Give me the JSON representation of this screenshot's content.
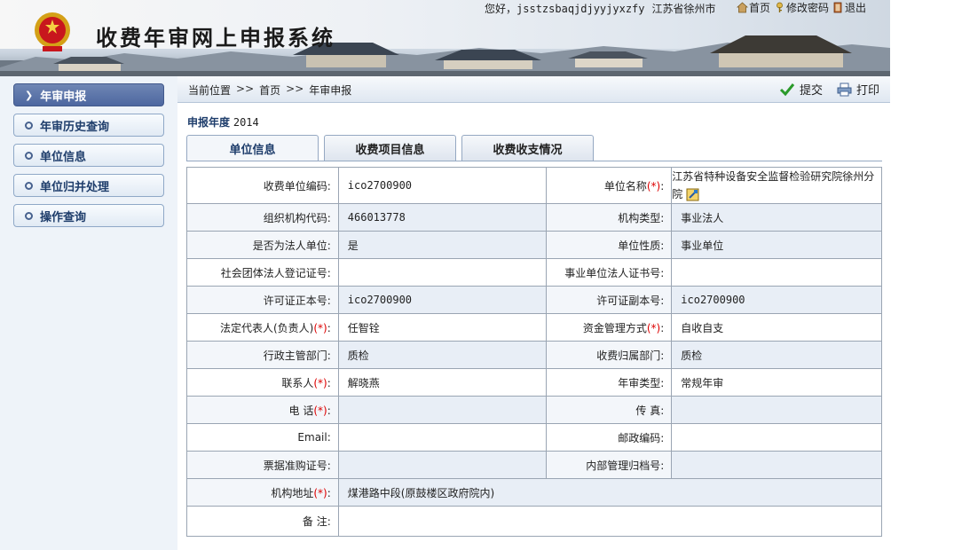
{
  "header": {
    "system_title": "收费年审网上申报系统",
    "greeting": "您好，",
    "username": "jsstzsbaqjdjyyjyxzfy",
    "city": "江苏省徐州市",
    "links": [
      {
        "label": "首页",
        "icon": "home-icon"
      },
      {
        "label": "修改密码",
        "icon": "key-icon"
      },
      {
        "label": "退出",
        "icon": "exit-icon"
      }
    ]
  },
  "sidebar": {
    "items": [
      {
        "label": "年审申报",
        "active": true
      },
      {
        "label": "年审历史查询",
        "active": false
      },
      {
        "label": "单位信息",
        "active": false
      },
      {
        "label": "单位归并处理",
        "active": false
      },
      {
        "label": "操作查询",
        "active": false
      }
    ]
  },
  "breadcrumb": {
    "prefix": "当前位置",
    "sep": ">>",
    "home": "首页",
    "current": "年审申报"
  },
  "actions": {
    "submit": "提交",
    "print": "打印"
  },
  "report_year": {
    "label": "申报年度",
    "value": "2014"
  },
  "tabs": [
    "单位信息",
    "收费项目信息",
    "收费收支情况"
  ],
  "form": {
    "unit_code": {
      "label": "收费单位编码:",
      "value": "ico2700900"
    },
    "unit_name": {
      "label": "单位名称",
      "value": "江苏省特种设备安全监督检验研究院徐州分院"
    },
    "org_code": {
      "label": "组织机构代码:",
      "value": "466013778"
    },
    "org_type": {
      "label": "机构类型:",
      "value": "事业法人"
    },
    "is_legal": {
      "label": "是否为法人单位:",
      "value": "是"
    },
    "unit_nature": {
      "label": "单位性质:",
      "value": "事业单位"
    },
    "social_cert": {
      "label": "社会团体法人登记证号:",
      "value": ""
    },
    "public_cert": {
      "label": "事业单位法人证书号:",
      "value": ""
    },
    "license_main": {
      "label": "许可证正本号:",
      "value": "ico2700900"
    },
    "license_copy": {
      "label": "许可证副本号:",
      "value": "ico2700900"
    },
    "legal_rep": {
      "label": "法定代表人(负责人)",
      "value": "任智铨"
    },
    "fund_mgmt": {
      "label": "资金管理方式",
      "value": "自收自支"
    },
    "admin_dept": {
      "label": "行政主管部门:",
      "value": "质检"
    },
    "fee_dept": {
      "label": "收费归属部门:",
      "value": "质检"
    },
    "contact": {
      "label": "联系人",
      "value": "解晓燕"
    },
    "review_type": {
      "label": "年审类型:",
      "value": "常规年审"
    },
    "phone": {
      "label": "电 话",
      "value": ""
    },
    "fax": {
      "label": "传 真:",
      "value": ""
    },
    "email": {
      "label": "Email:",
      "value": ""
    },
    "postcode": {
      "label": "邮政编码:",
      "value": ""
    },
    "bill_cert": {
      "label": "票据准购证号:",
      "value": ""
    },
    "archive_no": {
      "label": "内部管理归档号:",
      "value": ""
    },
    "address": {
      "label": "机构地址",
      "value": "煤港路中段(原鼓楼区政府院内)"
    },
    "remark": {
      "label": "备 注:",
      "value": ""
    },
    "required_mark": "(*)",
    "required_suffix": ":"
  }
}
